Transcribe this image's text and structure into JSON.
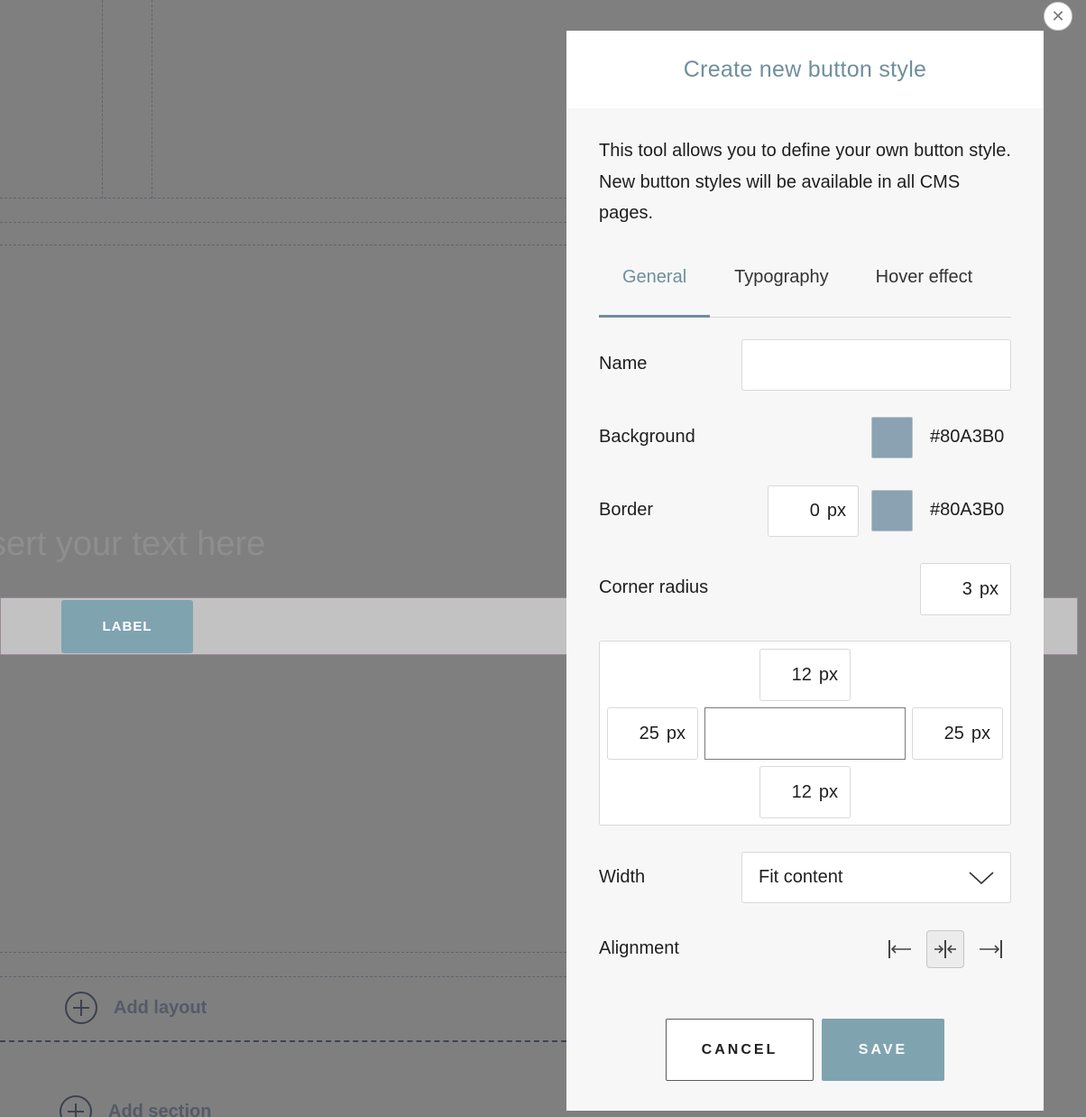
{
  "background_canvas": {
    "placeholder_text": "sert your text here",
    "label_button": "LABEL",
    "add_layout": "Add layout",
    "add_section": "Add section"
  },
  "modal": {
    "close_glyph": "✕",
    "title": "Create new button style",
    "intro": "This tool allows you to define your own button style. New button styles will be available in all CMS pages.",
    "tabs": [
      {
        "label": "General",
        "active": true
      },
      {
        "label": "Typography",
        "active": false
      },
      {
        "label": "Hover effect",
        "active": false
      }
    ],
    "fields": {
      "name": {
        "label": "Name",
        "value": ""
      },
      "background": {
        "label": "Background",
        "color": "#80A3B0",
        "hex_label": "#80A3B0"
      },
      "border": {
        "label": "Border",
        "width": "0",
        "unit": "px",
        "color": "#80A3B0",
        "hex_label": "#80A3B0"
      },
      "corner_radius": {
        "label": "Corner radius",
        "value": "3",
        "unit": "px"
      },
      "padding": {
        "top": {
          "value": "12",
          "unit": "px"
        },
        "left": {
          "value": "25",
          "unit": "px"
        },
        "right": {
          "value": "25",
          "unit": "px"
        },
        "bottom": {
          "value": "12",
          "unit": "px"
        }
      },
      "width": {
        "label": "Width",
        "selected": "Fit content"
      },
      "alignment": {
        "label": "Alignment",
        "options": [
          "left",
          "center",
          "right"
        ],
        "selected": "center"
      }
    },
    "actions": {
      "cancel": "CANCEL",
      "save": "SAVE"
    }
  }
}
